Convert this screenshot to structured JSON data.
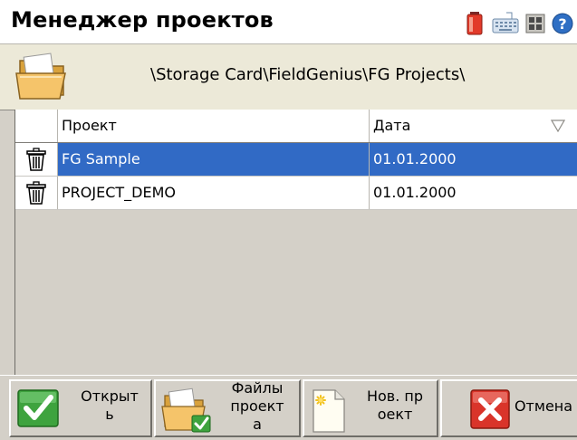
{
  "window": {
    "title": "Менеджер проектов"
  },
  "tray": {
    "icons": [
      "battery-icon",
      "keyboard-icon",
      "windows-icon",
      "help-icon"
    ]
  },
  "path_bar": {
    "icon": "folder-icon",
    "path": "\\Storage Card\\FieldGenius\\FG Projects\\"
  },
  "table": {
    "columns": [
      {
        "label": "Проект"
      },
      {
        "label": "Дата",
        "sort_icon": "sort-triangle-icon"
      }
    ],
    "rows": [
      {
        "project": "FG Sample",
        "date": "01.01.2000",
        "selected": true
      },
      {
        "project": "PROJECT_DEMO",
        "date": "01.01.2000",
        "selected": false
      }
    ]
  },
  "toolbar": {
    "open_label": "Открыт\nь",
    "files_label": "Файлы\nпроект\nа",
    "new_label": "Нов. пр\nоект",
    "cancel_label": "Отмена"
  },
  "colors": {
    "selection": "#316ac5",
    "background": "#d4d0c8",
    "folder": "#f2c265",
    "check": "#3ea33e",
    "cancel": "#d9342a"
  }
}
